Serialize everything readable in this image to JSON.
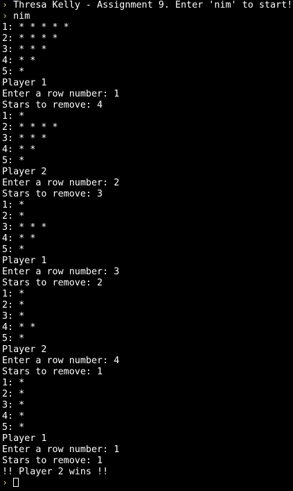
{
  "terminal": {
    "prompt_glyph": "›",
    "colors": {
      "background": "#000000",
      "text": "#ffffff",
      "prompt": "#e5c07b"
    },
    "lines": [
      {
        "kind": "prompt",
        "text": "Thresa Kelly - Assignment 9. Enter 'nim' to start!"
      },
      {
        "kind": "prompt",
        "text": "nim"
      },
      {
        "kind": "output",
        "text": "1: * * * * *"
      },
      {
        "kind": "output",
        "text": "2: * * * *"
      },
      {
        "kind": "output",
        "text": "3: * * *"
      },
      {
        "kind": "output",
        "text": "4: * *"
      },
      {
        "kind": "output",
        "text": "5: *"
      },
      {
        "kind": "output",
        "text": "Player 1"
      },
      {
        "kind": "output",
        "text": "Enter a row number: 1"
      },
      {
        "kind": "output",
        "text": "Stars to remove: 4"
      },
      {
        "kind": "output",
        "text": "1: *"
      },
      {
        "kind": "output",
        "text": "2: * * * *"
      },
      {
        "kind": "output",
        "text": "3: * * *"
      },
      {
        "kind": "output",
        "text": "4: * *"
      },
      {
        "kind": "output",
        "text": "5: *"
      },
      {
        "kind": "output",
        "text": "Player 2"
      },
      {
        "kind": "output",
        "text": "Enter a row number: 2"
      },
      {
        "kind": "output",
        "text": "Stars to remove: 3"
      },
      {
        "kind": "output",
        "text": "1: *"
      },
      {
        "kind": "output",
        "text": "2: *"
      },
      {
        "kind": "output",
        "text": "3: * * *"
      },
      {
        "kind": "output",
        "text": "4: * *"
      },
      {
        "kind": "output",
        "text": "5: *"
      },
      {
        "kind": "output",
        "text": "Player 1"
      },
      {
        "kind": "output",
        "text": "Enter a row number: 3"
      },
      {
        "kind": "output",
        "text": "Stars to remove: 2"
      },
      {
        "kind": "output",
        "text": "1: *"
      },
      {
        "kind": "output",
        "text": "2: *"
      },
      {
        "kind": "output",
        "text": "3: *"
      },
      {
        "kind": "output",
        "text": "4: * *"
      },
      {
        "kind": "output",
        "text": "5: *"
      },
      {
        "kind": "output",
        "text": "Player 2"
      },
      {
        "kind": "output",
        "text": "Enter a row number: 4"
      },
      {
        "kind": "output",
        "text": "Stars to remove: 1"
      },
      {
        "kind": "output",
        "text": "1: *"
      },
      {
        "kind": "output",
        "text": "2: *"
      },
      {
        "kind": "output",
        "text": "3: *"
      },
      {
        "kind": "output",
        "text": "4: *"
      },
      {
        "kind": "output",
        "text": "5: *"
      },
      {
        "kind": "output",
        "text": "Player 1"
      },
      {
        "kind": "output",
        "text": "Enter a row number: 1"
      },
      {
        "kind": "output",
        "text": "Stars to remove: 1"
      },
      {
        "kind": "output",
        "text": "!! Player 2 wins !!"
      },
      {
        "kind": "input",
        "text": ""
      }
    ]
  }
}
